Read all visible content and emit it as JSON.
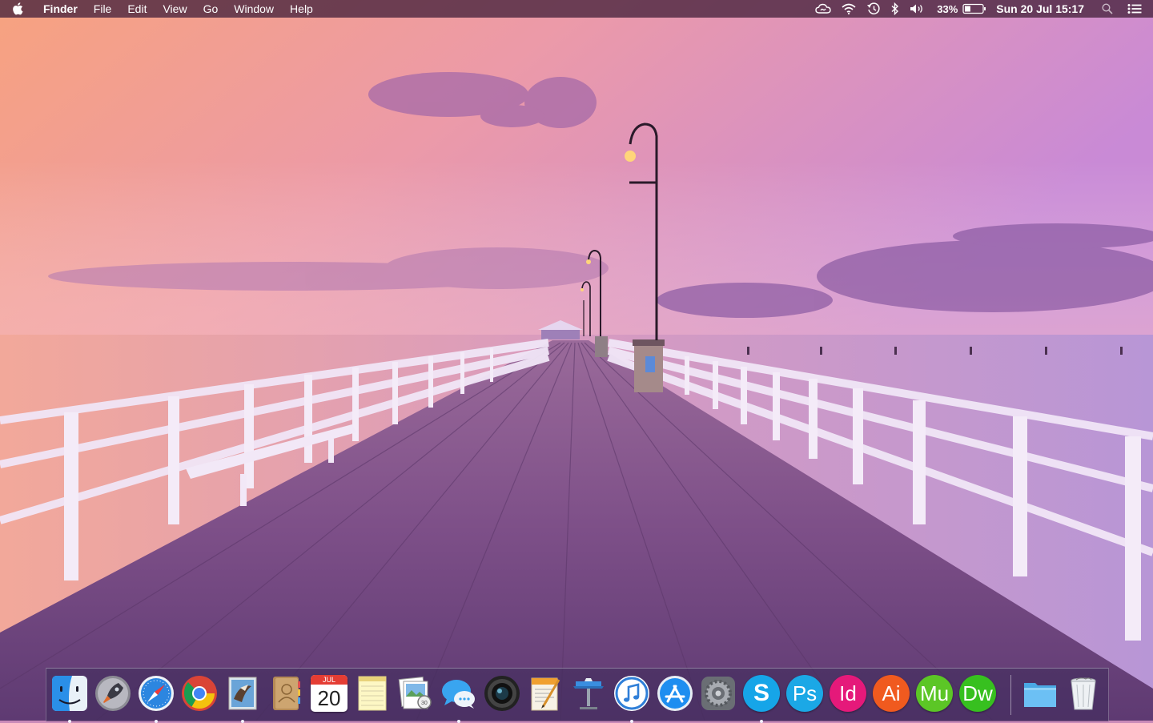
{
  "menubar": {
    "app_name": "Finder",
    "menus": [
      "File",
      "Edit",
      "View",
      "Go",
      "Window",
      "Help"
    ],
    "battery_percent": "33%",
    "battery_level": 0.33,
    "clock": "Sun 20 Jul  15:17",
    "status_icons": [
      "creative-cloud-icon",
      "wifi-icon",
      "time-machine-icon",
      "bluetooth-icon",
      "volume-icon",
      "battery-icon",
      "spotlight-icon",
      "notification-center-icon"
    ]
  },
  "dock": {
    "apps": [
      {
        "name": "Finder",
        "icon": "finder-icon",
        "running": true
      },
      {
        "name": "Launchpad",
        "icon": "launchpad-icon",
        "running": false
      },
      {
        "name": "Safari",
        "icon": "safari-icon",
        "running": true
      },
      {
        "name": "Google Chrome",
        "icon": "chrome-icon",
        "running": false
      },
      {
        "name": "Mail",
        "icon": "mail-icon",
        "running": true
      },
      {
        "name": "Contacts",
        "icon": "contacts-icon",
        "running": false
      },
      {
        "name": "Calendar",
        "icon": "calendar-icon",
        "running": false
      },
      {
        "name": "Notes",
        "icon": "notes-icon",
        "running": false
      },
      {
        "name": "Preview",
        "icon": "preview-icon",
        "running": false
      },
      {
        "name": "Messages",
        "icon": "messages-icon",
        "running": true
      },
      {
        "name": "Photo Booth",
        "icon": "photo-booth-icon",
        "running": false
      },
      {
        "name": "Pages",
        "icon": "pages-icon",
        "running": false
      },
      {
        "name": "Keynote",
        "icon": "keynote-icon",
        "running": false
      },
      {
        "name": "iTunes",
        "icon": "itunes-icon",
        "running": true
      },
      {
        "name": "App Store",
        "icon": "app-store-icon",
        "running": false
      },
      {
        "name": "System Preferences",
        "icon": "system-preferences-icon",
        "running": false
      },
      {
        "name": "Skype",
        "icon": "skype-icon",
        "running": true
      },
      {
        "name": "Photoshop",
        "icon": "photoshop-icon",
        "label": "Ps",
        "color": "#1ba8e6",
        "running": false
      },
      {
        "name": "InDesign",
        "icon": "indesign-icon",
        "label": "Id",
        "color": "#e5197a",
        "running": false
      },
      {
        "name": "Illustrator",
        "icon": "illustrator-icon",
        "label": "Ai",
        "color": "#f05a1f",
        "running": false
      },
      {
        "name": "Muse",
        "icon": "muse-icon",
        "label": "Mu",
        "color": "#5cc626",
        "running": false
      },
      {
        "name": "Dreamweaver",
        "icon": "dreamweaver-icon",
        "label": "Dw",
        "color": "#37c01f",
        "running": false
      }
    ],
    "calendar_month": "JUL",
    "calendar_day": "20",
    "stack": {
      "name": "Applications folder",
      "icon": "folder-icon"
    },
    "trash": {
      "name": "Trash",
      "icon": "trash-icon"
    }
  },
  "wallpaper": {
    "description_icon": "pier-sunset-wallpaper",
    "sky_top": "#f3a08a",
    "sky_right": "#c98ad6",
    "sea": "#b592d0",
    "deck": "#7a4a84"
  }
}
